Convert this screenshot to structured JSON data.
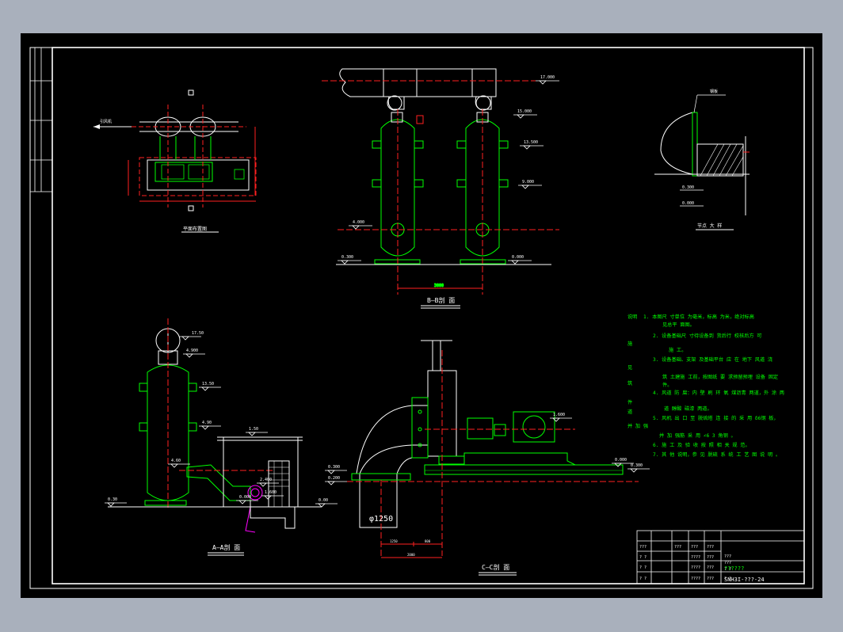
{
  "colors": {
    "background": "#a9b0bc",
    "canvas": "#000000",
    "line": "#00ff00",
    "center": "#ff2020",
    "white": "#ffffff",
    "yellow": "#ffff00",
    "magenta": "#ff00ff"
  },
  "views": {
    "plan_title": "平面布置图",
    "bb_title": "B—B剖 面",
    "aa_title": "A—A剖 面",
    "cc_title": "C—C剖 面",
    "detail_title": "节点 大 样"
  },
  "elevations": {
    "bb_top": "17.000",
    "bb_mid1": "15.000",
    "bb_mid2": "13.500",
    "bb_mid3": "9.000",
    "bb_low": "4.000",
    "bb_ground_left": "0.300",
    "bb_ground_right": "0.000",
    "aa_top": "17.50",
    "aa_2": "4.900",
    "aa_3": "13.50",
    "aa_4": "4.90",
    "aa_5": "4.60",
    "aa_6": "1.50",
    "aa_ground": "0.30",
    "aa_7": "2.400",
    "aa_8": "1.600",
    "aa_9": "0.000",
    "aa_10": "0.00",
    "cc_1": "1.600",
    "cc_2": "0.300",
    "cc_3": "0.200",
    "cc_4": "0.000",
    "cc_5": "0.300",
    "detail_1": "0.300",
    "detail_2": "0.000"
  },
  "dimensions": {
    "bb_span": "3000",
    "cc_pipe": "φ1250",
    "cc_dim1": "1250",
    "cc_dim2": "800",
    "cc_dim3": "2000",
    "plan_label": "引风机",
    "detail_label": "钢板"
  },
  "notes": {
    "heading": "说明",
    "lines": [
      "1. 本图尺 寸单位 为毫米，标高 为米，绝对标高",
      "见总平 面图。",
      "2. 设备基础尺 寸待设备到 货后行 校核后方 可",
      "施 工。",
      "3. 设备基础、支架 及基础平台 应 在 地下 风道 浇",
      "筑 土建施 工前，按图纸 要 求预留预埋 设备 固定",
      "件。",
      "4. 风道 防 腐：内 壁 刷 环 氧 煤沥青 两道，外 涂 两",
      "道 醇酸 磁漆 两道。",
      "5. 风机 出 口 至 脱硫塔 连 接 的 采 用 δ6钢 板，",
      "并 加 强筋 采 用 ∠6 3 角钢 。",
      "6. 施 工 及 验 收 按 照 相 关 规 范。",
      "7. 其 他 说明，参 见 脱硫 系 统 工 艺 图 说 明 。"
    ],
    "side_chars": [
      "施",
      "见",
      "筑",
      "件",
      "道",
      "并 加 强"
    ]
  },
  "title_block": {
    "rows": [
      [
        "???",
        "???",
        "???",
        "???"
      ],
      [
        "? ?",
        "",
        "????",
        "???"
      ],
      [
        "? ?",
        "",
        "????",
        "???"
      ],
      [
        "? ?",
        "",
        "????",
        "???"
      ]
    ],
    "col2": [
      "???",
      "???",
      "? ?",
      "? ?"
    ],
    "name": "??????",
    "number": "SNH3I-???-24"
  }
}
